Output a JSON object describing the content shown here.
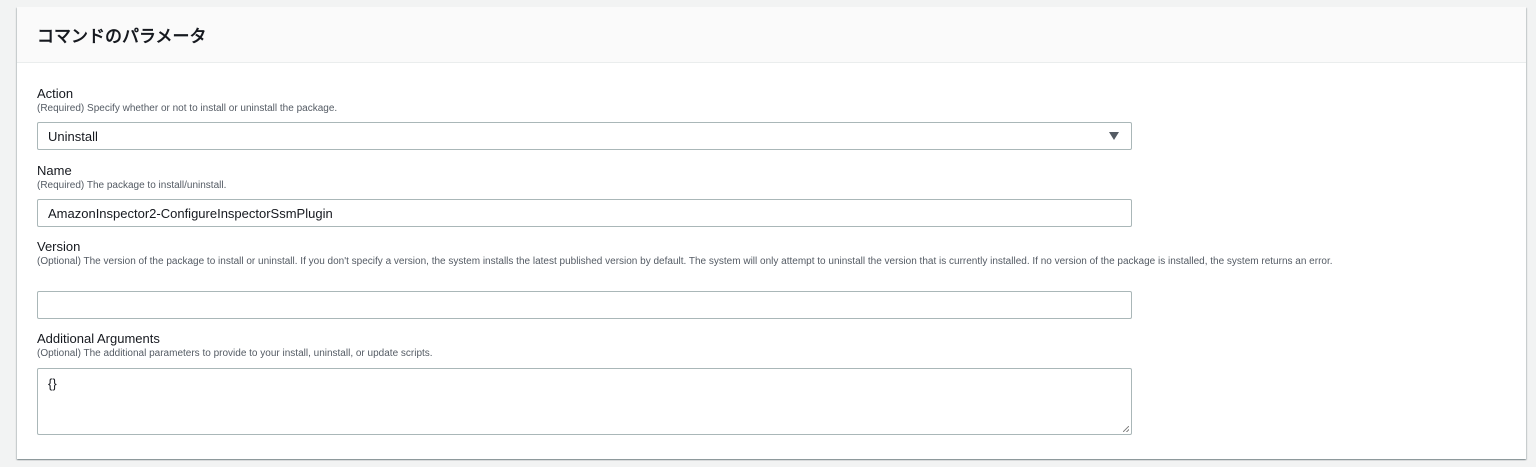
{
  "panel": {
    "title": "コマンドのパラメータ"
  },
  "fields": [
    {
      "label": "Action",
      "description": "(Required) Specify whether or not to install or uninstall the package.",
      "value": "Uninstall"
    },
    {
      "label": "Name",
      "description": "(Required) The package to install/uninstall.",
      "value": "AmazonInspector2-ConfigureInspectorSsmPlugin"
    },
    {
      "label": "Version",
      "description": "(Optional) The version of the package to install or uninstall. If you don't specify a version, the system installs the latest published version by default. The system will only attempt to uninstall the version that is currently installed. If no version of the package is installed, the system returns an error.",
      "value": ""
    },
    {
      "label": "Additional Arguments",
      "description": "(Optional) The additional parameters to provide to your install, uninstall, or update scripts.",
      "value": "{}"
    }
  ]
}
